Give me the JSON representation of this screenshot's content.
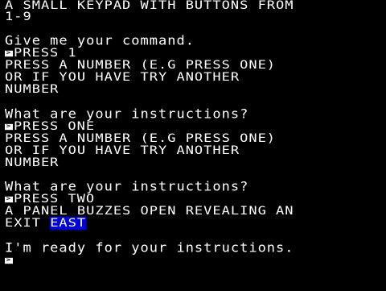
{
  "screen": {
    "colors": {
      "background": "#000000",
      "text": "#ffffff",
      "highlight": "#0000d8"
    },
    "input_marker": ">",
    "lines": [
      {
        "kind": "caps",
        "text": "A SMALL KEYPAD WITH BUTTONS FROM"
      },
      {
        "kind": "caps",
        "text": "1-9"
      },
      {
        "kind": "prompt",
        "text": "Give me your command."
      },
      {
        "kind": "input",
        "text": "PRESS 1"
      },
      {
        "kind": "caps",
        "text": "PRESS A NUMBER (E.G PRESS ONE)"
      },
      {
        "kind": "caps",
        "text": "OR IF YOU HAVE TRY ANOTHER"
      },
      {
        "kind": "caps",
        "text": "NUMBER"
      },
      {
        "kind": "prompt",
        "text": "What are your instructions?"
      },
      {
        "kind": "input",
        "text": "PRESS ONE"
      },
      {
        "kind": "caps",
        "text": "PRESS A NUMBER (E.G PRESS ONE)"
      },
      {
        "kind": "caps",
        "text": "OR IF YOU HAVE TRY ANOTHER"
      },
      {
        "kind": "caps",
        "text": "NUMBER"
      },
      {
        "kind": "prompt",
        "text": "What are your instructions?"
      },
      {
        "kind": "input",
        "text": "PRESS TWO"
      },
      {
        "kind": "caps",
        "text": "A PANEL BUZZES OPEN REVEALING AN"
      },
      {
        "kind": "exit",
        "text": "EXIT ",
        "highlight": "EAST"
      },
      {
        "kind": "prompt",
        "text": "I'm ready for your instructions."
      },
      {
        "kind": "cursor",
        "text": ""
      }
    ]
  }
}
